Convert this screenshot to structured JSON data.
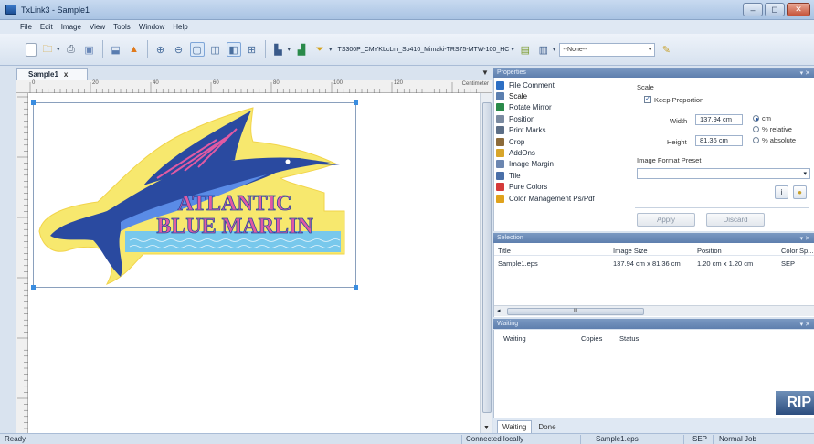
{
  "window": {
    "title": "TxLink3 - Sample1",
    "minimize": "‒",
    "maximize": "◻",
    "close": "✕"
  },
  "menu": [
    "File",
    "Edit",
    "Image",
    "View",
    "Tools",
    "Window",
    "Help"
  ],
  "toolbar": {
    "printer": "TS300P_CMYKLcLm_Sb410_Mimaki-TRS75-MTW-100_HC",
    "preset": "--None--"
  },
  "document": {
    "tab": "Sample1",
    "tab_close": "x",
    "dropdown": "▼",
    "ruler_unit": "Centimeter",
    "ruler_labels": [
      "0",
      "20",
      "40",
      "60",
      "80",
      "100",
      "120"
    ]
  },
  "artwork": {
    "line1": "ATLANTIC",
    "line2": "BLUE MARLIN",
    "colors": {
      "navy": "#2a4aa0",
      "blue": "#5a8be6",
      "yellow": "#f7e86e",
      "water": "#78c8ec",
      "pink": "#e15aa3"
    }
  },
  "properties": {
    "header": "Properties",
    "controls": "▾ ✕",
    "items": [
      {
        "label": "File Comment",
        "icon": "info-icon",
        "color": "#2d6fc4"
      },
      {
        "label": "Scale",
        "icon": "scale-icon",
        "color": "#5b7fb0",
        "selected": true
      },
      {
        "label": "Rotate Mirror",
        "icon": "rotate-icon",
        "color": "#2a8a4a"
      },
      {
        "label": "Position",
        "icon": "position-icon",
        "color": "#7a8aa0"
      },
      {
        "label": "Print Marks",
        "icon": "print-marks-icon",
        "color": "#5c6e86"
      },
      {
        "label": "Crop",
        "icon": "crop-icon",
        "color": "#8c6b3a"
      },
      {
        "label": "AddOns",
        "icon": "addons-icon",
        "color": "#d7a52a"
      },
      {
        "label": "Image Margin",
        "icon": "margin-icon",
        "color": "#6b86b0"
      },
      {
        "label": "Tile",
        "icon": "tile-icon",
        "color": "#4a6fa8"
      },
      {
        "label": "Pure Colors",
        "icon": "pure-colors-icon",
        "color": "#d43a3a"
      },
      {
        "label": "Color Management Ps/Pdf",
        "icon": "color-management-icon",
        "color": "#e0a21c"
      }
    ],
    "scale": {
      "title": "Scale",
      "keep_proportion": "Keep Proportion",
      "width_label": "Width",
      "width_value": "137.94 cm",
      "height_label": "Height",
      "height_value": "81.36 cm",
      "unit_cm": "cm",
      "unit_relative": "% relative",
      "unit_absolute": "% absolute",
      "format_preset_label": "Image Format Preset",
      "apply": "Apply",
      "discard": "Discard"
    }
  },
  "selection": {
    "header": "Selection",
    "controls": "▾ ✕",
    "columns": [
      "Title",
      "Image Size",
      "Position",
      "Color Sp..."
    ],
    "rows": [
      [
        "Sample1.eps",
        "137.94 cm x 81.36 cm",
        "1.20 cm x 1.20 cm",
        "SEP"
      ]
    ],
    "scroll_marker": "III"
  },
  "waiting": {
    "header": "Waiting",
    "controls": "▾ ✕",
    "columns": [
      "Waiting",
      "Copies",
      "Status"
    ],
    "logo": "RIP"
  },
  "bottom_tabs": [
    "Waiting",
    "Done"
  ],
  "status": {
    "left": "Ready",
    "connection": "Connected locally",
    "file": "Sample1.eps",
    "mode": "SEP",
    "job": "Normal Job"
  }
}
